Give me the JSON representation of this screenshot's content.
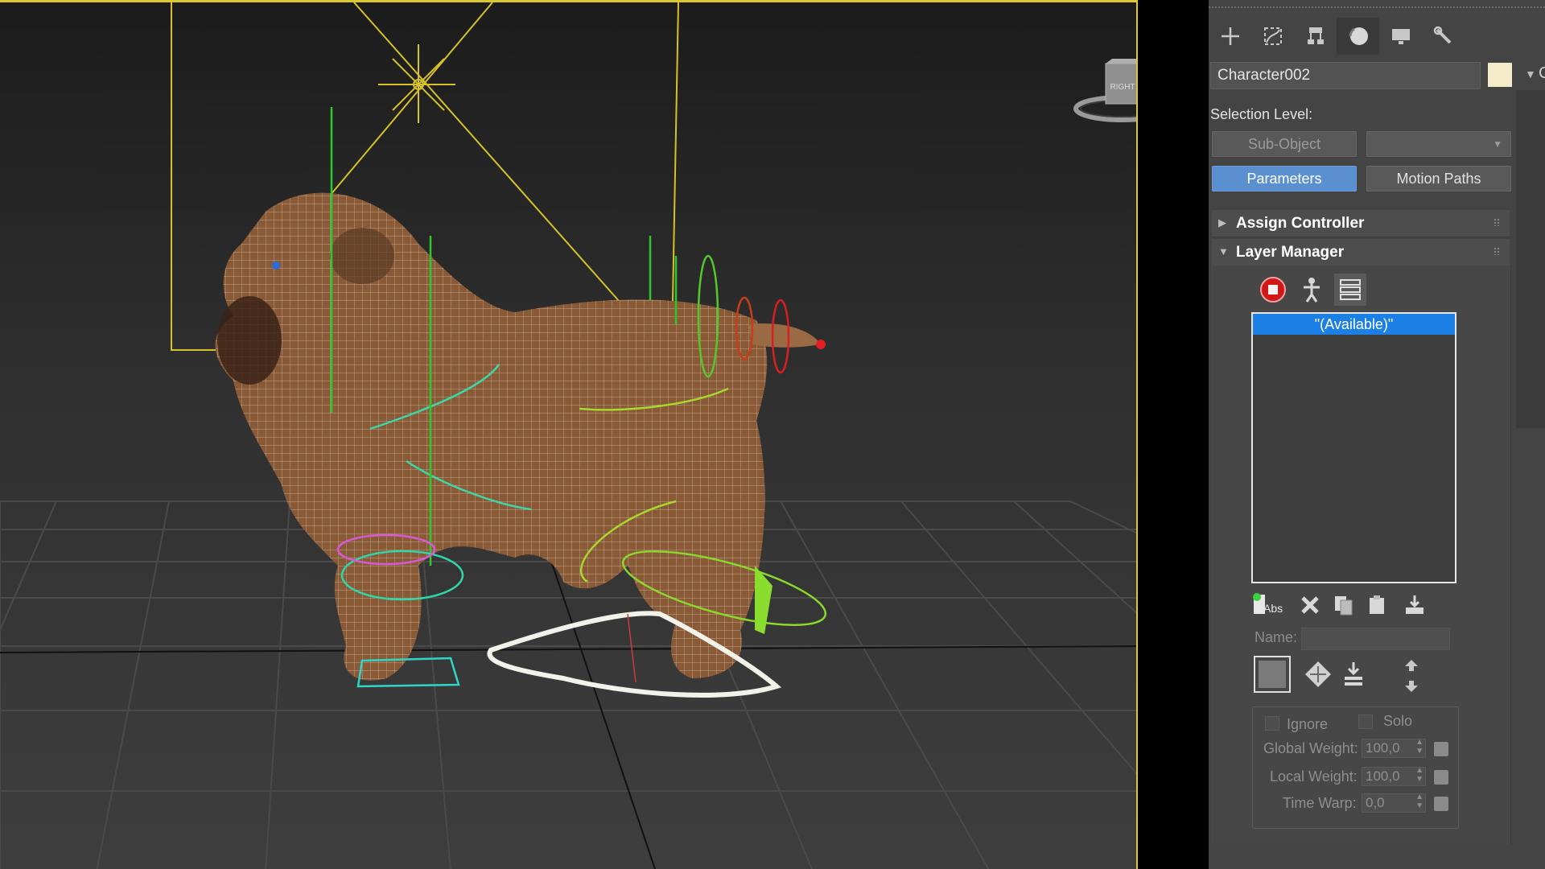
{
  "command_panel": {
    "tabs": [
      {
        "name": "create",
        "glyph": "+"
      },
      {
        "name": "modify",
        "glyph": "◸"
      },
      {
        "name": "hierarchy",
        "glyph": "⊓"
      },
      {
        "name": "motion",
        "glyph": "●"
      },
      {
        "name": "display",
        "glyph": "▬"
      },
      {
        "name": "utilities",
        "glyph": "🔧"
      }
    ],
    "object_name": "Character002",
    "object_color": "#f4ecc8",
    "side_letter": "C",
    "selection_level_label": "Selection Level:",
    "sub_object_label": "Sub-Object",
    "parameters_label": "Parameters",
    "motion_paths_label": "Motion Paths",
    "assign_controller_title": "Assign Controller",
    "layer_manager_title": "Layer Manager",
    "layers": [
      "\"(Available)\""
    ],
    "abs_label": "Abs",
    "name_label": "Name:",
    "ignore_label": "Ignore",
    "solo_label": "Solo",
    "global_weight_label": "Global Weight:",
    "global_weight_value": "100,0",
    "local_weight_label": "Local Weight:",
    "local_weight_value": "100,0",
    "time_warp_label": "Time Warp:",
    "time_warp_value": "0,0"
  },
  "viewport": {
    "viewcube_face": "RIGHT",
    "active_border_color": "#d9c832"
  },
  "colors": {
    "accent_blue": "#5a8fd0",
    "selection_blue": "#1c7fe6",
    "panel_bg": "#444444"
  }
}
